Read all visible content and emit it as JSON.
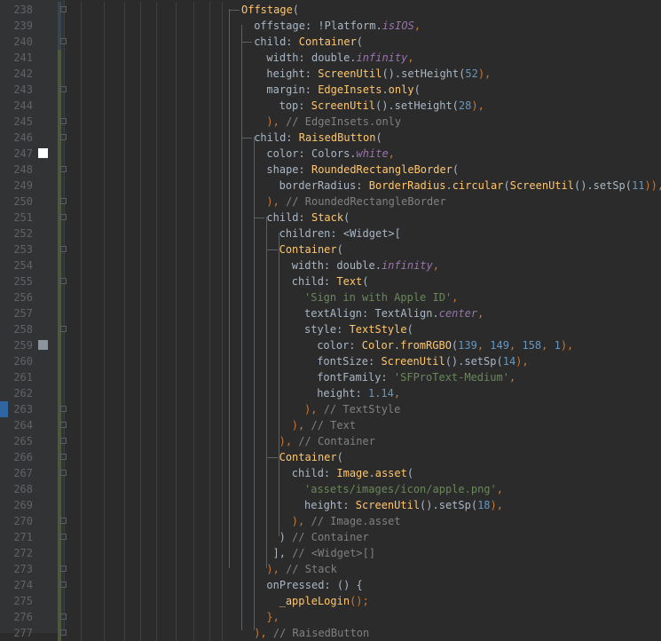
{
  "editor": {
    "colors": {
      "background": "#2b2b2b",
      "gutter": "#313335",
      "line_number": "#606366",
      "vcs_modified": "#374752",
      "vcs_added": "#4d5a3a",
      "swatch_white": "#ffffff",
      "swatch_grey": "#8b959e"
    },
    "lines": [
      {
        "num": "238",
        "indent": 0,
        "tokens": [
          {
            "t": "Offstage",
            "c": "c"
          },
          {
            "t": "(",
            "c": "p"
          }
        ]
      },
      {
        "num": "239",
        "indent": 1,
        "tokens": [
          {
            "t": "offstage: !",
            "c": "p"
          },
          {
            "t": "Platform.",
            "c": "p"
          },
          {
            "t": "isIOS",
            "c": "f"
          },
          {
            "t": ",",
            "c": "k"
          }
        ]
      },
      {
        "num": "240",
        "indent": 1,
        "tokens": [
          {
            "t": "child: ",
            "c": "p"
          },
          {
            "t": "Container",
            "c": "c"
          },
          {
            "t": "(",
            "c": "p"
          }
        ]
      },
      {
        "num": "241",
        "indent": 2,
        "tokens": [
          {
            "t": "width: double.",
            "c": "p"
          },
          {
            "t": "infinity",
            "c": "f"
          },
          {
            "t": ",",
            "c": "k"
          }
        ]
      },
      {
        "num": "242",
        "indent": 2,
        "tokens": [
          {
            "t": "height: ",
            "c": "p"
          },
          {
            "t": "ScreenUtil",
            "c": "c"
          },
          {
            "t": "().setHeight(",
            "c": "p"
          },
          {
            "t": "52",
            "c": "n"
          },
          {
            "t": "),",
            "c": "k"
          }
        ]
      },
      {
        "num": "243",
        "indent": 2,
        "tokens": [
          {
            "t": "margin: ",
            "c": "p"
          },
          {
            "t": "EdgeInsets",
            "c": "c"
          },
          {
            "t": ".",
            "c": "p"
          },
          {
            "t": "only",
            "c": "c"
          },
          {
            "t": "(",
            "c": "p"
          }
        ]
      },
      {
        "num": "244",
        "indent": 3,
        "tokens": [
          {
            "t": "top: ",
            "c": "p"
          },
          {
            "t": "ScreenUtil",
            "c": "c"
          },
          {
            "t": "().setHeight(",
            "c": "p"
          },
          {
            "t": "28",
            "c": "n"
          },
          {
            "t": "),",
            "c": "k"
          }
        ]
      },
      {
        "num": "245",
        "indent": 2,
        "tokens": [
          {
            "t": "), ",
            "c": "k"
          },
          {
            "t": "// EdgeInsets.only",
            "c": "cm"
          }
        ]
      },
      {
        "num": "246",
        "indent": 1,
        "tokens": [
          {
            "t": "child: ",
            "c": "p"
          },
          {
            "t": "RaisedButton",
            "c": "c"
          },
          {
            "t": "(",
            "c": "p"
          }
        ]
      },
      {
        "num": "247",
        "indent": 2,
        "tokens": [
          {
            "t": "color: Colors.",
            "c": "p"
          },
          {
            "t": "white",
            "c": "f"
          },
          {
            "t": ",",
            "c": "k"
          }
        ]
      },
      {
        "num": "248",
        "indent": 2,
        "tokens": [
          {
            "t": "shape: ",
            "c": "p"
          },
          {
            "t": "RoundedRectangleBorder",
            "c": "c"
          },
          {
            "t": "(",
            "c": "p"
          }
        ]
      },
      {
        "num": "249",
        "indent": 3,
        "tokens": [
          {
            "t": "borderRadius: ",
            "c": "p"
          },
          {
            "t": "BorderRadius",
            "c": "c"
          },
          {
            "t": ".",
            "c": "p"
          },
          {
            "t": "circular",
            "c": "c"
          },
          {
            "t": "(",
            "c": "p"
          },
          {
            "t": "ScreenUtil",
            "c": "c"
          },
          {
            "t": "().setSp(",
            "c": "p"
          },
          {
            "t": "11",
            "c": "n"
          },
          {
            "t": ")),",
            "c": "k"
          }
        ]
      },
      {
        "num": "250",
        "indent": 2,
        "tokens": [
          {
            "t": "), ",
            "c": "k"
          },
          {
            "t": "// RoundedRectangleBorder",
            "c": "cm"
          }
        ]
      },
      {
        "num": "251",
        "indent": 2,
        "tokens": [
          {
            "t": "child: ",
            "c": "p"
          },
          {
            "t": "Stack",
            "c": "c"
          },
          {
            "t": "(",
            "c": "p"
          }
        ]
      },
      {
        "num": "252",
        "indent": 3,
        "tokens": [
          {
            "t": "children: <Widget>[",
            "c": "p"
          }
        ]
      },
      {
        "num": "253",
        "indent": 3,
        "tokens": [
          {
            "t": "Container",
            "c": "c"
          },
          {
            "t": "(",
            "c": "p"
          }
        ]
      },
      {
        "num": "254",
        "indent": 4,
        "tokens": [
          {
            "t": "width: double.",
            "c": "p"
          },
          {
            "t": "infinity",
            "c": "f"
          },
          {
            "t": ",",
            "c": "k"
          }
        ]
      },
      {
        "num": "255",
        "indent": 4,
        "tokens": [
          {
            "t": "child: ",
            "c": "p"
          },
          {
            "t": "Text",
            "c": "c"
          },
          {
            "t": "(",
            "c": "p"
          }
        ]
      },
      {
        "num": "256",
        "indent": 5,
        "tokens": [
          {
            "t": "'Sign in with Apple ID'",
            "c": "s"
          },
          {
            "t": ",",
            "c": "k"
          }
        ]
      },
      {
        "num": "257",
        "indent": 5,
        "tokens": [
          {
            "t": "textAlign: TextAlign.",
            "c": "p"
          },
          {
            "t": "center",
            "c": "f"
          },
          {
            "t": ",",
            "c": "k"
          }
        ]
      },
      {
        "num": "258",
        "indent": 5,
        "tokens": [
          {
            "t": "style: ",
            "c": "p"
          },
          {
            "t": "TextStyle",
            "c": "c"
          },
          {
            "t": "(",
            "c": "p"
          }
        ]
      },
      {
        "num": "259",
        "indent": 6,
        "tokens": [
          {
            "t": "color: ",
            "c": "p"
          },
          {
            "t": "Color",
            "c": "c"
          },
          {
            "t": ".",
            "c": "p"
          },
          {
            "t": "fromRGBO",
            "c": "c"
          },
          {
            "t": "(",
            "c": "p"
          },
          {
            "t": "139",
            "c": "n"
          },
          {
            "t": ", ",
            "c": "k"
          },
          {
            "t": "149",
            "c": "n"
          },
          {
            "t": ", ",
            "c": "k"
          },
          {
            "t": "158",
            "c": "n"
          },
          {
            "t": ", ",
            "c": "k"
          },
          {
            "t": "1",
            "c": "n"
          },
          {
            "t": "),",
            "c": "k"
          }
        ]
      },
      {
        "num": "260",
        "indent": 6,
        "tokens": [
          {
            "t": "fontSize: ",
            "c": "p"
          },
          {
            "t": "ScreenUtil",
            "c": "c"
          },
          {
            "t": "().setSp(",
            "c": "p"
          },
          {
            "t": "14",
            "c": "n"
          },
          {
            "t": "),",
            "c": "k"
          }
        ]
      },
      {
        "num": "261",
        "indent": 6,
        "tokens": [
          {
            "t": "fontFamily: ",
            "c": "p"
          },
          {
            "t": "'SFProText-Medium'",
            "c": "s"
          },
          {
            "t": ",",
            "c": "k"
          }
        ]
      },
      {
        "num": "262",
        "indent": 6,
        "tokens": [
          {
            "t": "height: ",
            "c": "p"
          },
          {
            "t": "1.14",
            "c": "n"
          },
          {
            "t": ",",
            "c": "k"
          }
        ]
      },
      {
        "num": "263",
        "indent": 5,
        "tokens": [
          {
            "t": "), ",
            "c": "k"
          },
          {
            "t": "// TextStyle",
            "c": "cm"
          }
        ]
      },
      {
        "num": "264",
        "indent": 4,
        "tokens": [
          {
            "t": "), ",
            "c": "k"
          },
          {
            "t": "// Text",
            "c": "cm"
          }
        ]
      },
      {
        "num": "265",
        "indent": 3,
        "tokens": [
          {
            "t": "), ",
            "c": "k"
          },
          {
            "t": "// Container",
            "c": "cm"
          }
        ]
      },
      {
        "num": "266",
        "indent": 3,
        "tokens": [
          {
            "t": "Container",
            "c": "c"
          },
          {
            "t": "(",
            "c": "p"
          }
        ]
      },
      {
        "num": "267",
        "indent": 4,
        "tokens": [
          {
            "t": "child: ",
            "c": "p"
          },
          {
            "t": "Image",
            "c": "c"
          },
          {
            "t": ".",
            "c": "p"
          },
          {
            "t": "asset",
            "c": "c"
          },
          {
            "t": "(",
            "c": "p"
          }
        ]
      },
      {
        "num": "268",
        "indent": 5,
        "tokens": [
          {
            "t": "'assets/images/icon/apple.png'",
            "c": "s"
          },
          {
            "t": ",",
            "c": "k"
          }
        ]
      },
      {
        "num": "269",
        "indent": 5,
        "tokens": [
          {
            "t": "height: ",
            "c": "p"
          },
          {
            "t": "ScreenUtil",
            "c": "c"
          },
          {
            "t": "().setSp(",
            "c": "p"
          },
          {
            "t": "18",
            "c": "n"
          },
          {
            "t": "),",
            "c": "k"
          }
        ]
      },
      {
        "num": "270",
        "indent": 4,
        "tokens": [
          {
            "t": "), ",
            "c": "k"
          },
          {
            "t": "// Image.asset",
            "c": "cm"
          }
        ]
      },
      {
        "num": "271",
        "indent": 3,
        "tokens": [
          {
            "t": ") ",
            "c": "p"
          },
          {
            "t": "// Container",
            "c": "cm"
          }
        ]
      },
      {
        "num": "272",
        "indent": 2.5,
        "tokens": [
          {
            "t": "], ",
            "c": "p"
          },
          {
            "t": "// <Widget>[]",
            "c": "cm"
          }
        ]
      },
      {
        "num": "273",
        "indent": 2,
        "tokens": [
          {
            "t": "), ",
            "c": "k"
          },
          {
            "t": "// Stack",
            "c": "cm"
          }
        ]
      },
      {
        "num": "274",
        "indent": 2,
        "tokens": [
          {
            "t": "onPressed: () {",
            "c": "p"
          }
        ]
      },
      {
        "num": "275",
        "indent": 3,
        "tokens": [
          {
            "t": "_appleLogin",
            "c": "c"
          },
          {
            "t": "();",
            "c": "k"
          }
        ]
      },
      {
        "num": "276",
        "indent": 2,
        "tokens": [
          {
            "t": "},",
            "c": "k"
          }
        ]
      },
      {
        "num": "277",
        "indent": 1,
        "tokens": [
          {
            "t": "), ",
            "c": "k"
          },
          {
            "t": "// RaisedButton",
            "c": "cm"
          }
        ]
      }
    ]
  }
}
